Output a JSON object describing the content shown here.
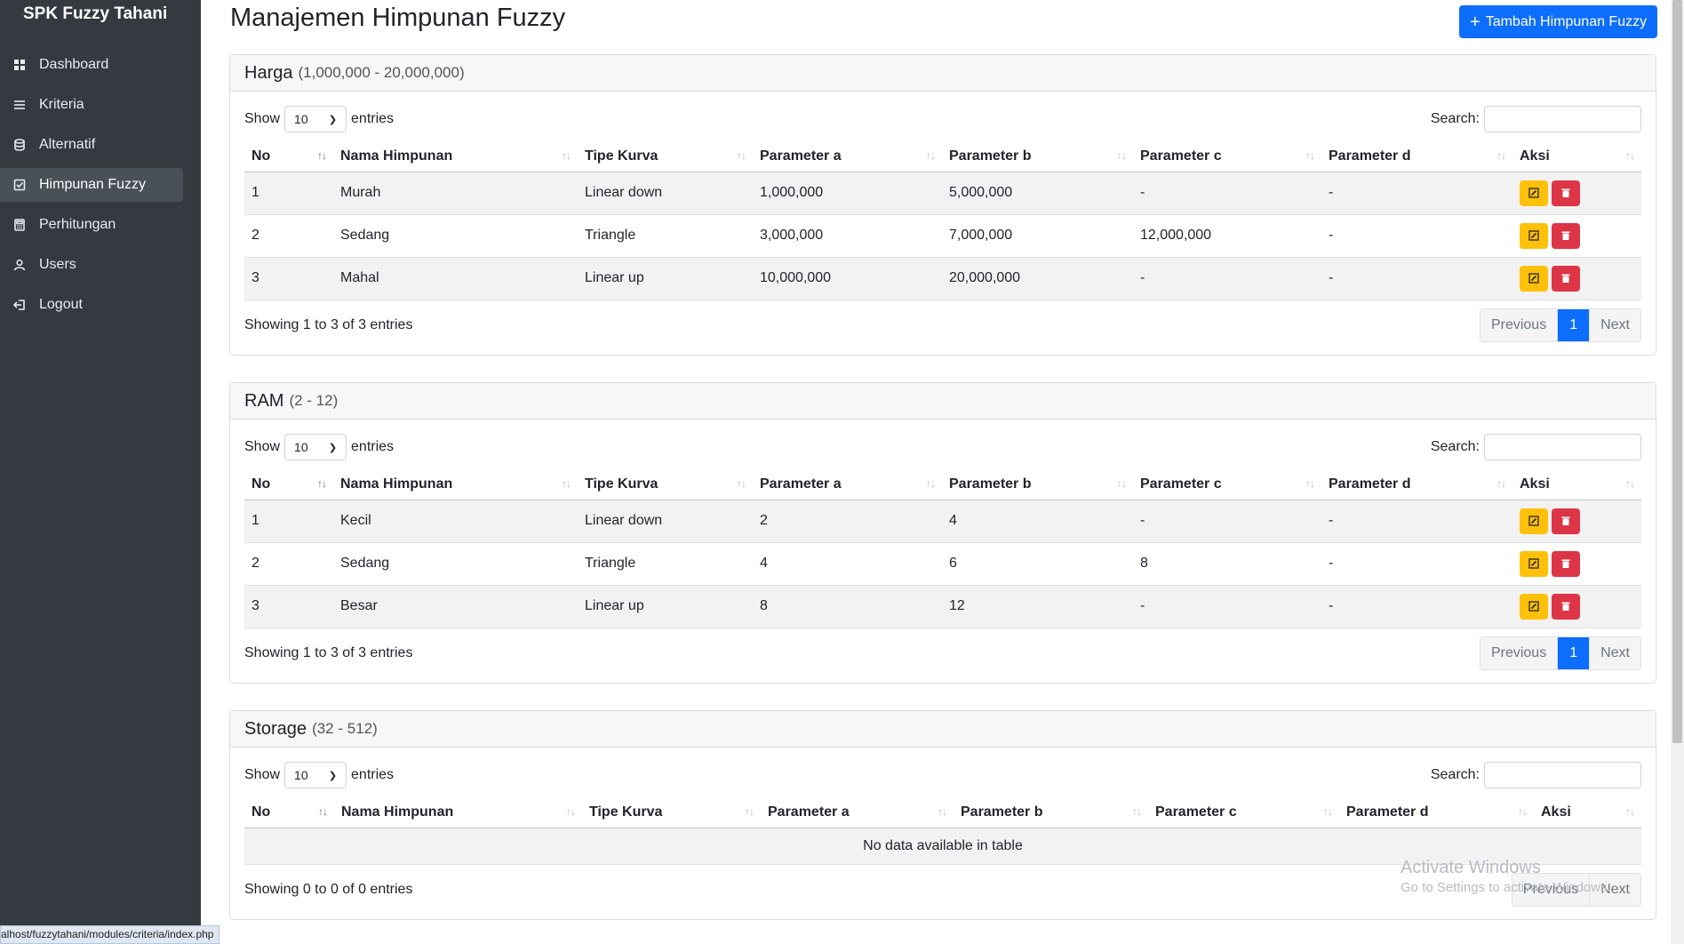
{
  "sidebar": {
    "brand": "SPK Fuzzy Tahani",
    "items": [
      {
        "label": "Dashboard",
        "icon": "grid-icon"
      },
      {
        "label": "Kriteria",
        "icon": "list-icon"
      },
      {
        "label": "Alternatif",
        "icon": "database-icon"
      },
      {
        "label": "Himpunan Fuzzy",
        "icon": "check-square-icon",
        "active": true
      },
      {
        "label": "Perhitungan",
        "icon": "calculator-icon"
      },
      {
        "label": "Users",
        "icon": "person-icon"
      },
      {
        "label": "Logout",
        "icon": "logout-icon"
      }
    ]
  },
  "header": {
    "title": "Manajemen Himpunan Fuzzy",
    "add_button": "Tambah Himpunan Fuzzy"
  },
  "table_labels": {
    "show": "Show",
    "entries": "entries",
    "page_size": "10",
    "search": "Search:",
    "previous": "Previous",
    "next": "Next",
    "page": "1",
    "columns": [
      "No",
      "Nama Himpunan",
      "Tipe Kurva",
      "Parameter a",
      "Parameter b",
      "Parameter c",
      "Parameter d",
      "Aksi"
    ]
  },
  "cards": [
    {
      "title": "Harga",
      "range": "(1,000,000 - 20,000,000)",
      "info": "Showing 1 to 3 of 3 entries",
      "rows": [
        [
          "1",
          "Murah",
          "Linear down",
          "1,000,000",
          "5,000,000",
          "-",
          "-"
        ],
        [
          "2",
          "Sedang",
          "Triangle",
          "3,000,000",
          "7,000,000",
          "12,000,000",
          "-"
        ],
        [
          "3",
          "Mahal",
          "Linear up",
          "10,000,000",
          "20,000,000",
          "-",
          "-"
        ]
      ]
    },
    {
      "title": "RAM",
      "range": "(2 - 12)",
      "info": "Showing 1 to 3 of 3 entries",
      "rows": [
        [
          "1",
          "Kecil",
          "Linear down",
          "2",
          "4",
          "-",
          "-"
        ],
        [
          "2",
          "Sedang",
          "Triangle",
          "4",
          "6",
          "8",
          "-"
        ],
        [
          "3",
          "Besar",
          "Linear up",
          "8",
          "12",
          "-",
          "-"
        ]
      ]
    },
    {
      "title": "Storage",
      "range": "(32 - 512)",
      "info": "Showing 0 to 0 of 0 entries",
      "empty_text": "No data available in table",
      "rows": []
    }
  ],
  "status_url": "alhost/fuzzytahani/modules/criteria/index.php",
  "watermark": {
    "line1": "Activate Windows",
    "line2": "Go to Settings to activate Windows."
  },
  "colors": {
    "sidebar_bg": "#343a40",
    "primary": "#0d6efd",
    "warning": "#ffc107",
    "danger": "#dc3545"
  }
}
